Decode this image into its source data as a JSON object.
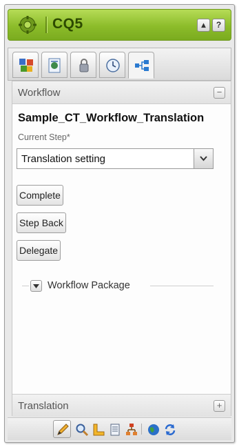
{
  "header": {
    "app_title": "CQ5",
    "logo_icon": "cq5-gear-logo-icon",
    "buttons": [
      {
        "icon": "caret-up-icon",
        "glyph": "▴"
      },
      {
        "icon": "help-icon",
        "glyph": "?"
      }
    ]
  },
  "tabs": [
    {
      "icon": "components-icon",
      "active": false
    },
    {
      "icon": "page-icon",
      "active": false
    },
    {
      "icon": "lock-icon",
      "active": false
    },
    {
      "icon": "clock-icon",
      "active": false
    },
    {
      "icon": "workflow-icon",
      "active": true
    }
  ],
  "workflow": {
    "section_label": "Workflow",
    "collapse_glyph": "−",
    "title": "Sample_CT_Workflow_Translation",
    "current_step_label": "Current Step*",
    "current_step_value": "Translation setting",
    "buttons": {
      "complete": "Complete",
      "step_back": "Step Back",
      "delegate": "Delegate"
    },
    "package_label": "Workflow Package"
  },
  "translation": {
    "section_label": "Translation",
    "expand_glyph": "+"
  },
  "toolbar": {
    "tools": [
      "pencil-icon",
      "magnifier-icon",
      "ruler-icon",
      "document-icon",
      "tree-icon",
      "globe-icon",
      "refresh-icon"
    ],
    "active_tool": "pencil-icon"
  },
  "colors": {
    "header_green": "#8cbc2a",
    "header_text": "#2d4a00"
  }
}
